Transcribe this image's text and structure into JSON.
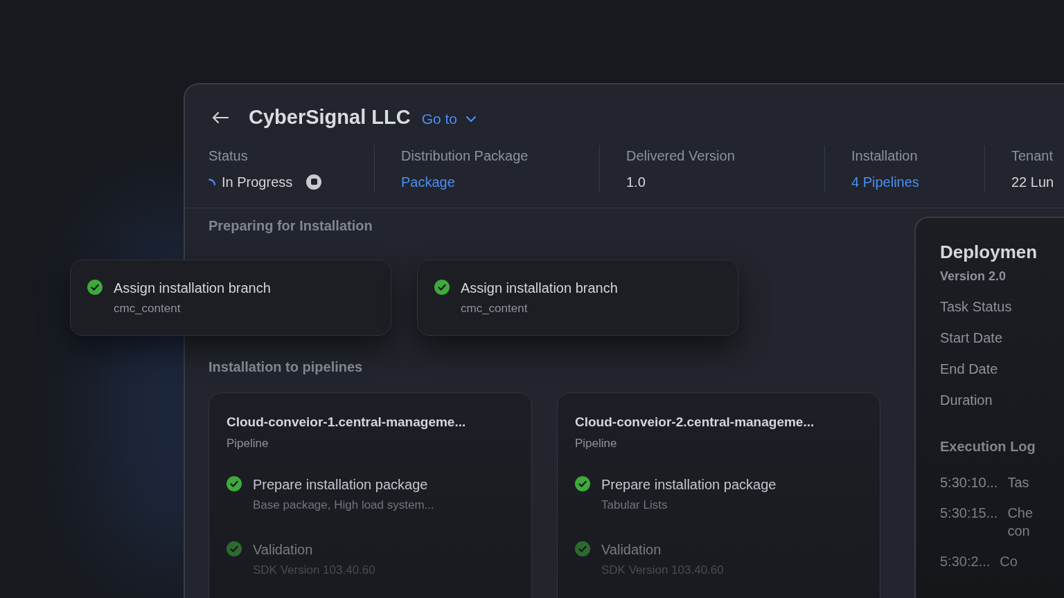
{
  "header": {
    "title": "CyberSignal LLC",
    "goto": "Go to"
  },
  "stats": [
    {
      "label": "Status",
      "value": "In Progress",
      "kind": "status"
    },
    {
      "label": "Distribution Package",
      "value": "Package",
      "kind": "link"
    },
    {
      "label": "Delivered Version",
      "value": "1.0",
      "kind": "text"
    },
    {
      "label": "Installation",
      "value": "4 Pipelines",
      "kind": "link"
    },
    {
      "label": "Tenant",
      "value": "22 Lun",
      "kind": "text"
    }
  ],
  "preparing": {
    "title": "Preparing for Installation",
    "tasks": [
      {
        "title": "Assign installation branch",
        "subtitle": "cmc_content",
        "done": true
      },
      {
        "title": "Assign installation branch",
        "subtitle": "cmc_content",
        "done": true
      }
    ]
  },
  "pipelines": {
    "title": "Installation to pipelines",
    "cards": [
      {
        "name": "Cloud-conveior-1.central-manageme...",
        "type": "Pipeline",
        "steps": [
          {
            "title": "Prepare installation package",
            "subtitle": "Base package, High load system...",
            "done": true
          },
          {
            "title": "Validation",
            "subtitle": "SDK Version 103.40.60",
            "done": true
          }
        ]
      },
      {
        "name": "Cloud-conveior-2.central-manageme...",
        "type": "Pipeline",
        "steps": [
          {
            "title": "Prepare installation package",
            "subtitle": "Tabular Lists",
            "done": true
          },
          {
            "title": "Validation",
            "subtitle": "SDK Version 103.40.60",
            "done": true
          }
        ]
      }
    ]
  },
  "deployment": {
    "title": "Deploymen",
    "version": "Version 2.0",
    "fields": [
      "Task Status",
      "Start Date",
      "End Date",
      "Duration"
    ],
    "log_title": "Execution Log",
    "log": [
      {
        "time": "5:30:10...",
        "message": [
          "Tas"
        ]
      },
      {
        "time": "5:30:15...",
        "message": [
          "Che",
          "con"
        ]
      },
      {
        "time": "5:30:2...",
        "message": [
          "Co"
        ]
      }
    ]
  }
}
